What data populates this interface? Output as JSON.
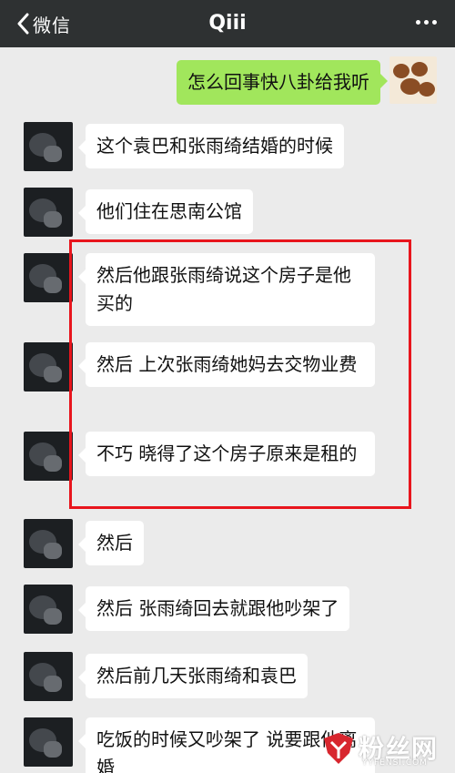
{
  "header": {
    "back_label": "微信",
    "title": "Qiii"
  },
  "messages": [
    {
      "side": "right",
      "text": "怎么回事快八卦给我听"
    },
    {
      "side": "left",
      "text": "这个袁巴和张雨绮结婚的时候"
    },
    {
      "side": "left",
      "text": "他们住在思南公馆"
    },
    {
      "side": "left",
      "text": "然后他跟张雨绮说这个房子是他买的"
    },
    {
      "side": "left",
      "text": "然后 上次张雨绮她妈去交物业费"
    },
    {
      "side": "left",
      "text": "不巧 晓得了这个房子原来是租的"
    },
    {
      "side": "left",
      "text": "然后"
    },
    {
      "side": "left",
      "text": "然后 张雨绮回去就跟他吵架了"
    },
    {
      "side": "left",
      "text": "然后前几天张雨绮和袁巴"
    },
    {
      "side": "left",
      "text": "吃饭的时候又吵架了 说要跟他离婚"
    }
  ],
  "watermark": {
    "text": "粉丝网",
    "url": "YYFENSI.COM"
  },
  "colors": {
    "topbar": "#2e3132",
    "background": "#ebebeb",
    "bubble_right": "#a1e65c",
    "bubble_left": "#ffffff",
    "highlight": "#e8151d"
  },
  "icons": [
    "back-chevron-icon",
    "more-icon",
    "avatar-bears",
    "avatar-dark"
  ]
}
